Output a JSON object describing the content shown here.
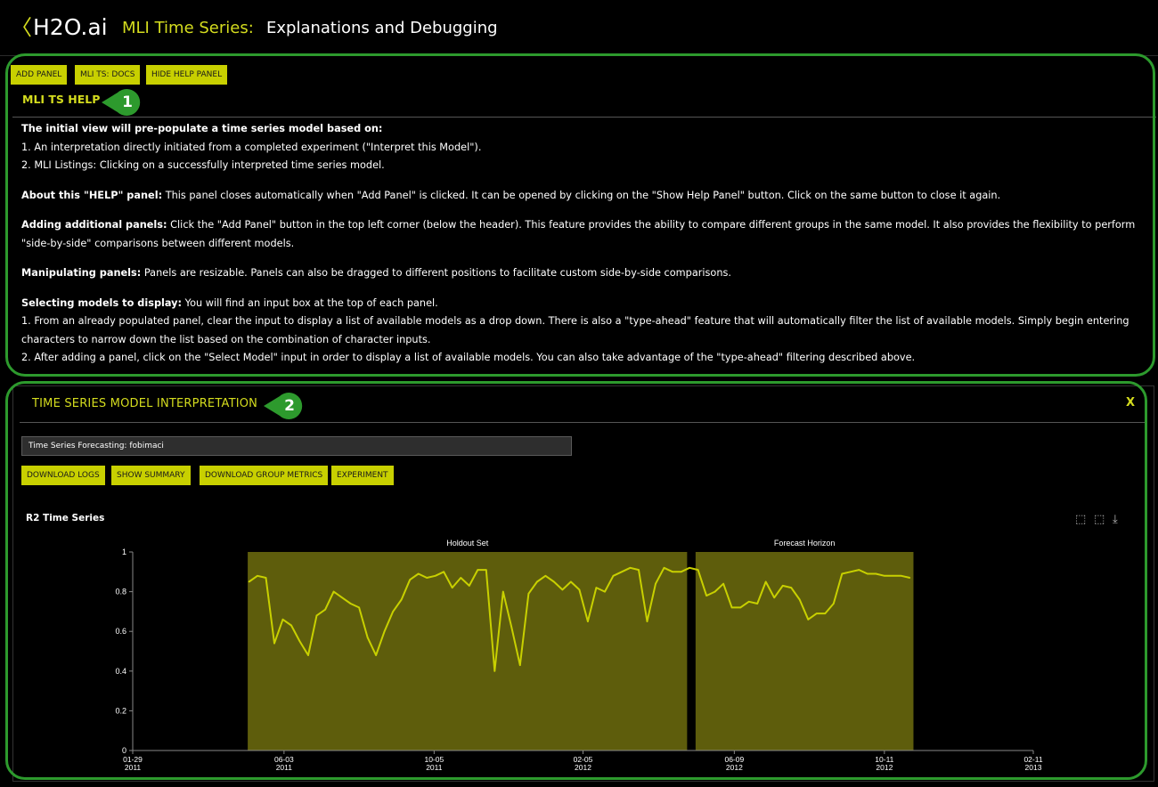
{
  "header": {
    "back_icon": "chevron-left-icon",
    "brand": "H2O.ai",
    "section": "MLI Time Series:",
    "subtitle": "Explanations and Debugging"
  },
  "toolbar": {
    "add_panel": "ADD PANEL",
    "docs": "MLI TS: DOCS",
    "hide_help": "HIDE HELP PANEL"
  },
  "help": {
    "title": "MLI TS HELP",
    "callout": "1",
    "intro_heading": "The initial view will pre-populate a time series model based on:",
    "intro_items": [
      "1. An interpretation directly initiated from a completed experiment (\"Interpret this Model\").",
      "2. MLI Listings: Clicking on a successfully interpreted time series model."
    ],
    "about_heading": "About this \"HELP\" panel:",
    "about_text": " This panel closes automatically when \"Add Panel\" is clicked. It can be opened by clicking on the \"Show Help Panel\" button. Click on the same button to close it again.",
    "adding_heading": "Adding additional panels:",
    "adding_text": " Click the \"Add Panel\" button in the top left corner (below the header). This feature provides the ability to compare different groups in the same model. It also provides the flexibility to perform \"side-by-side\" comparisons between different models.",
    "manip_heading": "Manipulating panels:",
    "manip_text": " Panels are resizable. Panels can also be dragged to different positions to facilitate custom side-by-side comparisons.",
    "select_heading": "Selecting models to display:",
    "select_text": " You will find an input box at the top of each panel.",
    "select_items": [
      "1. From an already populated panel, clear the input to display a list of available models as a drop down. There is also a \"type-ahead\" feature that will automatically filter the list of available models. Simply begin entering characters to narrow down the list based on the combination of character inputs.",
      "2. After adding a panel, click on the \"Select Model\" input in order to display a list of available models. You can also take advantage of the \"type-ahead\" filtering described above."
    ]
  },
  "ts_panel": {
    "title": "TIME SERIES MODEL INTERPRETATION",
    "callout": "2",
    "close": "X",
    "model_value": "Time Series Forecasting: fobimaci",
    "buttons": [
      "DOWNLOAD LOGS",
      "SHOW SUMMARY",
      "DOWNLOAD GROUP METRICS",
      "EXPERIMENT"
    ],
    "chart_icons": [
      "zoom-in-icon",
      "zoom-reset-icon",
      "download-icon"
    ]
  },
  "colors": {
    "accent": "#d4dc1e",
    "button_bg": "#c8d000",
    "callout_green": "#2d9a2d",
    "region_fill": "#5e5d0c",
    "line": "#c8d000"
  },
  "chart_data": {
    "type": "line",
    "title": "R2 Time Series",
    "xlabel": "",
    "ylabel": "",
    "ylim": [
      0,
      1
    ],
    "yticks": [
      "0",
      "0.2",
      "0.4",
      "0.6",
      "0.8",
      "1"
    ],
    "xticks": [
      {
        "date": "2011-01-29",
        "label": [
          "01-29",
          "2011"
        ]
      },
      {
        "date": "2011-06-03",
        "label": [
          "06-03",
          "2011"
        ]
      },
      {
        "date": "2011-10-05",
        "label": [
          "10-05",
          "2011"
        ]
      },
      {
        "date": "2012-02-05",
        "label": [
          "02-05",
          "2012"
        ]
      },
      {
        "date": "2012-06-09",
        "label": [
          "06-09",
          "2012"
        ]
      },
      {
        "date": "2012-10-11",
        "label": [
          "10-11",
          "2012"
        ]
      },
      {
        "date": "2013-02-11",
        "label": [
          "02-11",
          "2013"
        ]
      }
    ],
    "regions": [
      {
        "name": "Holdout Set",
        "start": "2011-05-04",
        "end": "2012-05-01"
      },
      {
        "name": "Forecast Horizon",
        "start": "2012-05-08",
        "end": "2012-11-04"
      }
    ],
    "grid": false,
    "legend": "none",
    "series": [
      {
        "x": [
          "2011-05-05",
          "2011-05-12",
          "2011-05-19",
          "2011-05-26",
          "2011-06-02",
          "2011-06-09",
          "2011-06-16",
          "2011-06-23",
          "2011-06-30",
          "2011-07-07",
          "2011-07-14",
          "2011-07-21",
          "2011-07-28",
          "2011-08-04",
          "2011-08-11",
          "2011-08-18",
          "2011-08-25",
          "2011-09-01",
          "2011-09-08",
          "2011-09-15",
          "2011-09-22",
          "2011-09-29",
          "2011-10-06",
          "2011-10-13",
          "2011-10-20",
          "2011-10-27",
          "2011-11-03",
          "2011-11-10",
          "2011-11-17",
          "2011-11-24",
          "2011-12-01",
          "2011-12-08",
          "2011-12-15",
          "2011-12-22",
          "2011-12-29",
          "2012-01-05",
          "2012-01-12",
          "2012-01-19",
          "2012-01-26",
          "2012-02-02",
          "2012-02-09",
          "2012-02-16",
          "2012-02-23",
          "2012-03-01",
          "2012-03-08",
          "2012-03-15",
          "2012-03-22",
          "2012-03-29",
          "2012-04-05",
          "2012-04-12",
          "2012-04-19",
          "2012-04-26",
          "2012-05-03",
          "2012-05-10",
          "2012-05-17",
          "2012-05-24",
          "2012-05-31",
          "2012-06-07",
          "2012-06-14",
          "2012-06-21",
          "2012-06-28",
          "2012-07-05",
          "2012-07-12",
          "2012-07-19",
          "2012-07-26",
          "2012-08-02",
          "2012-08-09",
          "2012-08-16",
          "2012-08-23",
          "2012-08-30",
          "2012-09-06",
          "2012-09-13",
          "2012-09-20",
          "2012-09-27",
          "2012-10-04",
          "2012-10-11",
          "2012-10-18",
          "2012-10-25",
          "2012-11-01"
        ],
        "values": [
          0.85,
          0.88,
          0.87,
          0.54,
          0.66,
          0.63,
          0.55,
          0.48,
          0.68,
          0.71,
          0.8,
          0.77,
          0.74,
          0.72,
          0.57,
          0.48,
          0.6,
          0.7,
          0.76,
          0.86,
          0.89,
          0.87,
          0.88,
          0.9,
          0.82,
          0.87,
          0.83,
          0.91,
          0.91,
          0.4,
          0.8,
          0.62,
          0.43,
          0.79,
          0.85,
          0.88,
          0.85,
          0.81,
          0.85,
          0.81,
          0.65,
          0.82,
          0.8,
          0.88,
          0.9,
          0.92,
          0.91,
          0.65,
          0.84,
          0.92,
          0.9,
          0.9,
          0.92,
          0.91,
          0.78,
          0.8,
          0.84,
          0.72,
          0.72,
          0.75,
          0.74,
          0.85,
          0.77,
          0.83,
          0.82,
          0.76,
          0.66,
          0.69,
          0.69,
          0.74,
          0.89,
          0.9,
          0.91,
          0.89,
          0.89,
          0.88,
          0.88,
          0.88,
          0.87
        ]
      }
    ]
  }
}
